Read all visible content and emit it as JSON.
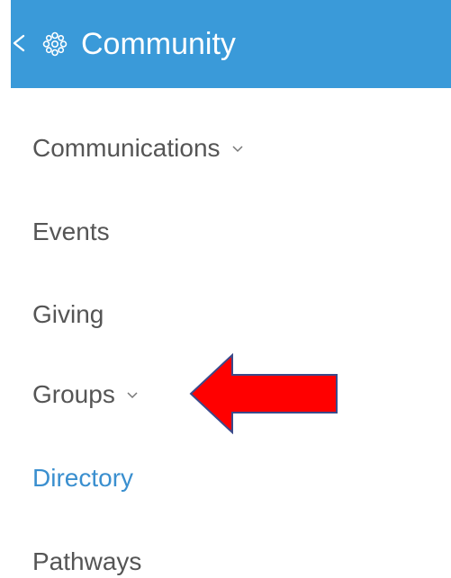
{
  "header": {
    "title": "Community",
    "color": "#3a9ad9"
  },
  "nav": {
    "items": [
      {
        "label": "Communications",
        "has_chevron": true,
        "active": false
      },
      {
        "label": "Events",
        "has_chevron": false,
        "active": false
      },
      {
        "label": "Giving",
        "has_chevron": false,
        "active": false
      },
      {
        "label": "Groups",
        "has_chevron": true,
        "active": false
      },
      {
        "label": "Directory",
        "has_chevron": false,
        "active": true
      },
      {
        "label": "Pathways",
        "has_chevron": false,
        "active": false
      }
    ],
    "active_color": "#3a8fcf",
    "text_color": "#555555"
  },
  "annotation": {
    "arrow_color": "#ff0000",
    "arrow_icon": "red-left-arrow-icon"
  }
}
